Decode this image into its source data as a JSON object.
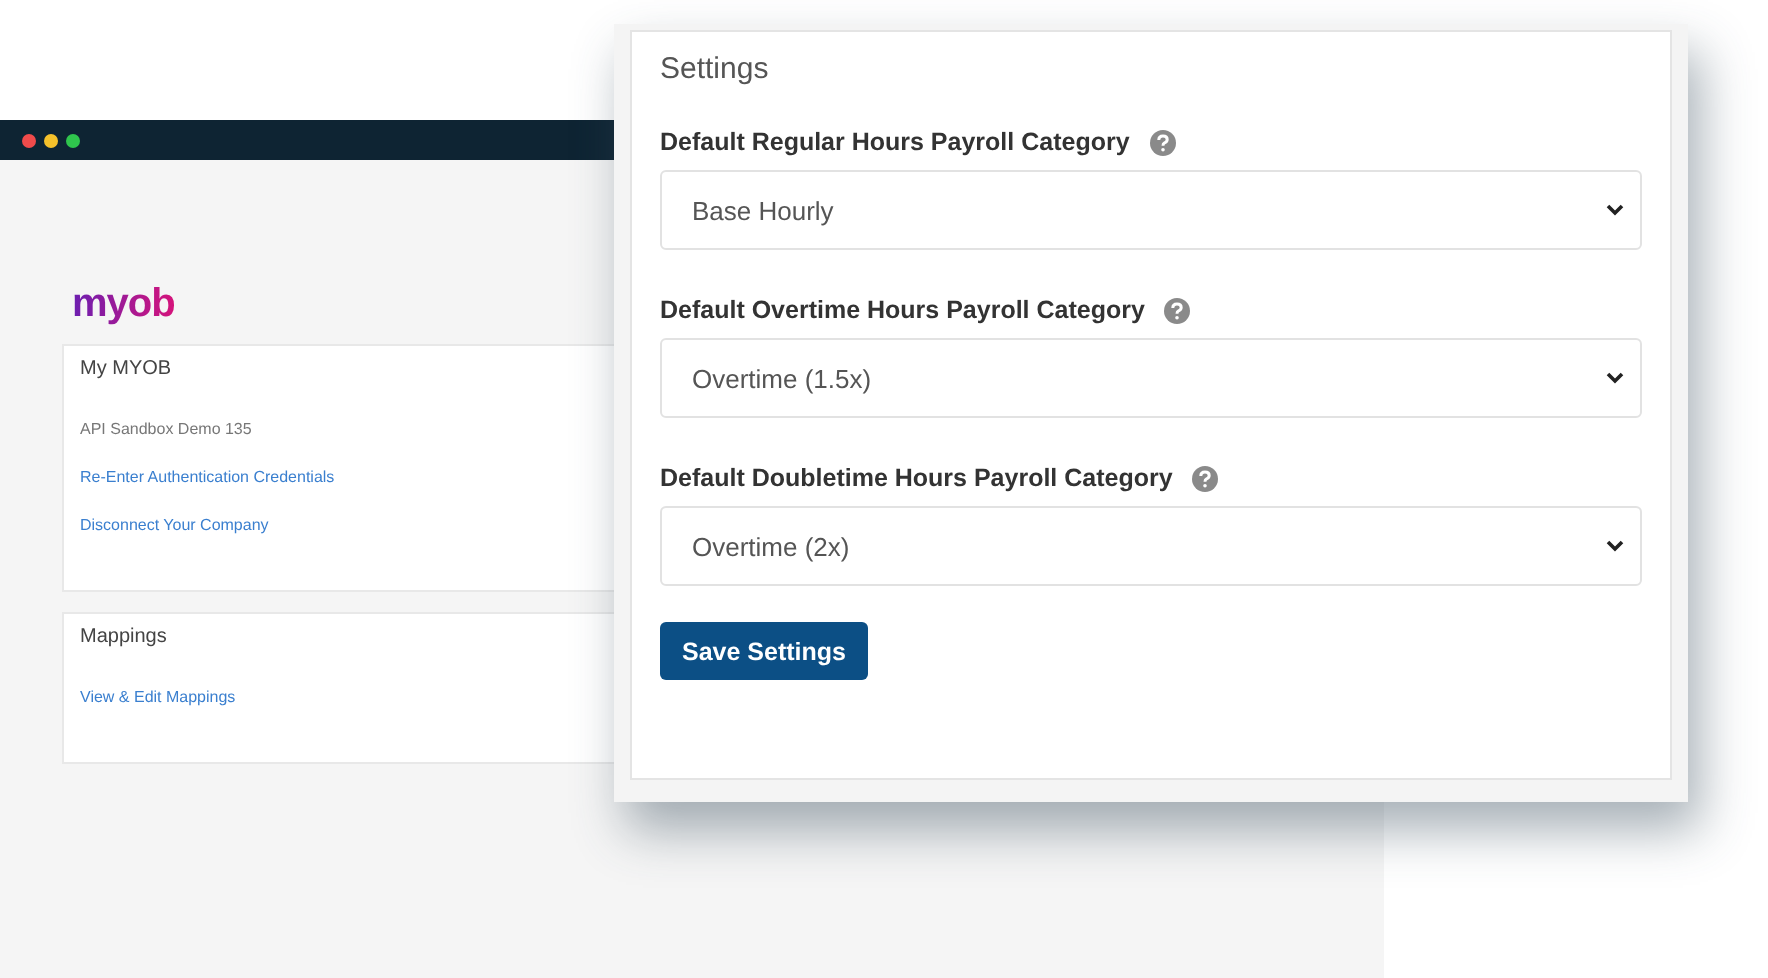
{
  "browser": {
    "logo": "myob",
    "cards": [
      {
        "title": "My MYOB",
        "lines": [
          {
            "kind": "text",
            "text": "API Sandbox Demo 135"
          },
          {
            "kind": "link",
            "text": "Re-Enter Authentication Credentials"
          },
          {
            "kind": "link",
            "text": "Disconnect Your Company"
          }
        ]
      },
      {
        "title": "Mappings",
        "lines": [
          {
            "kind": "link",
            "text": "View & Edit Mappings"
          }
        ]
      }
    ]
  },
  "settings": {
    "title": "Settings",
    "fields": [
      {
        "label": "Default Regular Hours Payroll Category",
        "value": "Base Hourly"
      },
      {
        "label": "Default Overtime Hours Payroll Category",
        "value": "Overtime (1.5x)"
      },
      {
        "label": "Default Doubletime Hours Payroll Category",
        "value": "Overtime (2x)"
      }
    ],
    "button": "Save Settings"
  }
}
